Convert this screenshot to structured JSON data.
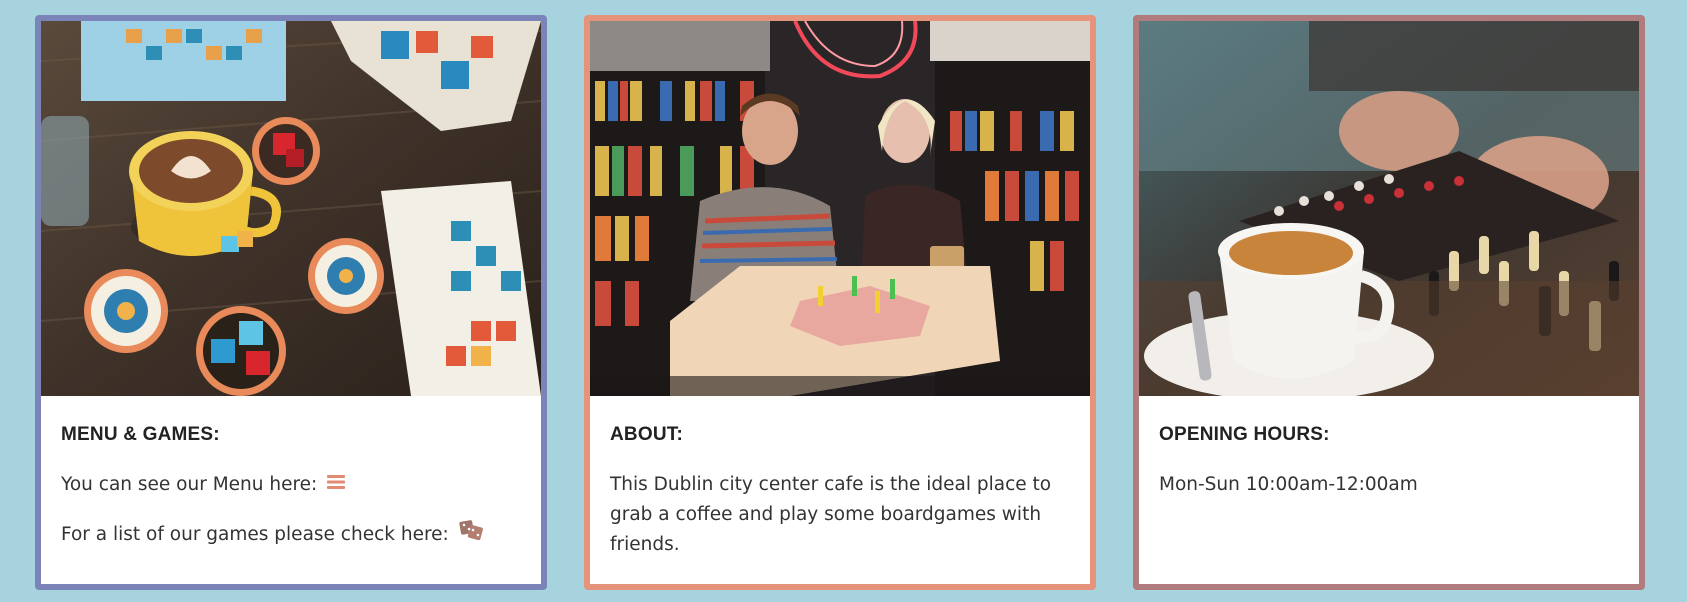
{
  "colors": {
    "page_background": "#a7d3de",
    "card1_border": "#7b84b8",
    "card2_border": "#e5937b",
    "card3_border": "#b07c7d",
    "icon_accent": "#e38a72"
  },
  "cards": [
    {
      "image": "board-games-and-latte-photo",
      "title": "MENU & GAMES:",
      "lines": [
        {
          "text": "You can see our Menu here:",
          "icon": "menu-bars-icon"
        },
        {
          "text": "For a list of our games please check here:",
          "icon": "dice-icon"
        }
      ]
    },
    {
      "image": "couple-playing-board-game-photo",
      "title": "ABOUT:",
      "lines": [
        {
          "text": "This Dublin city center cafe is the ideal place to grab a coffee and play some boardgames with friends."
        }
      ]
    },
    {
      "image": "coffee-and-chess-photo",
      "title": "OPENING HOURS:",
      "lines": [
        {
          "text": "Mon-Sun 10:00am-12:00am"
        }
      ]
    }
  ]
}
